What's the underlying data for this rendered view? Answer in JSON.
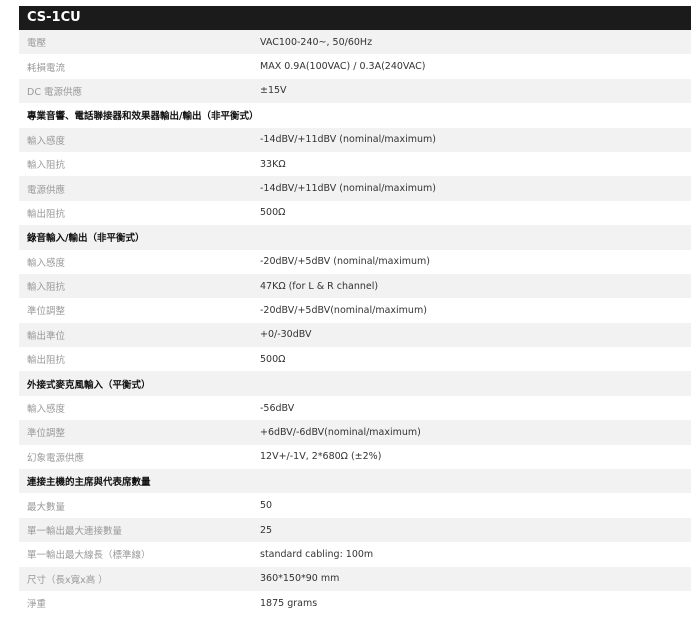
{
  "title": "CS-1CU",
  "rows": [
    {
      "type": "item",
      "label": "電壓",
      "value": "VAC100-240~, 50/60Hz"
    },
    {
      "type": "item",
      "label": "耗損電流",
      "value": "MAX 0.9A(100VAC) / 0.3A(240VAC)"
    },
    {
      "type": "item",
      "label": "DC 電源供應",
      "value": "±15V"
    },
    {
      "type": "section",
      "label": "專業音響、電話聯接器和效果器輸出/輸出（非平衡式）"
    },
    {
      "type": "item",
      "label": "輸入感度",
      "value": "-14dBV/+11dBV (nominal/maximum)"
    },
    {
      "type": "item",
      "label": "輸入阻抗",
      "value": "33KΩ"
    },
    {
      "type": "item",
      "label": "電源供應",
      "value": "-14dBV/+11dBV (nominal/maximum)"
    },
    {
      "type": "item",
      "label": "輸出阻抗",
      "value": "500Ω"
    },
    {
      "type": "section",
      "label": "錄音輸入/輸出（非平衡式）"
    },
    {
      "type": "item",
      "label": "輸入感度",
      "value": "-20dBV/+5dBV (nominal/maximum)"
    },
    {
      "type": "item",
      "label": "輸入阻抗",
      "value": "47KΩ (for L & R channel)"
    },
    {
      "type": "item",
      "label": "準位調整",
      "value": "-20dBV/+5dBV(nominal/maximum)"
    },
    {
      "type": "item",
      "label": "輸出準位",
      "value": "+0/-30dBV"
    },
    {
      "type": "item",
      "label": "輸出阻抗",
      "value": "500Ω"
    },
    {
      "type": "section",
      "label": "外接式麥克風輸入（平衡式）"
    },
    {
      "type": "item",
      "label": "輸入感度",
      "value": "-56dBV"
    },
    {
      "type": "item",
      "label": "準位調整",
      "value": "+6dBV/-6dBV(nominal/maximum)"
    },
    {
      "type": "item",
      "label": "幻象電源供應",
      "value": "12V+/-1V, 2*680Ω (±2%)"
    },
    {
      "type": "section",
      "label": "連接主機的主席與代表席數量"
    },
    {
      "type": "item",
      "label": "最大數量",
      "value": "50"
    },
    {
      "type": "item",
      "label": "單一輸出最大連接數量",
      "value": "25"
    },
    {
      "type": "item",
      "label": "單一輸出最大線長（標準線）",
      "value": "standard cabling: 100m"
    },
    {
      "type": "item",
      "label": "尺寸（長x寬x高 ）",
      "value": "360*150*90 mm"
    },
    {
      "type": "item",
      "label": "淨重",
      "value": "1875 grams"
    }
  ]
}
